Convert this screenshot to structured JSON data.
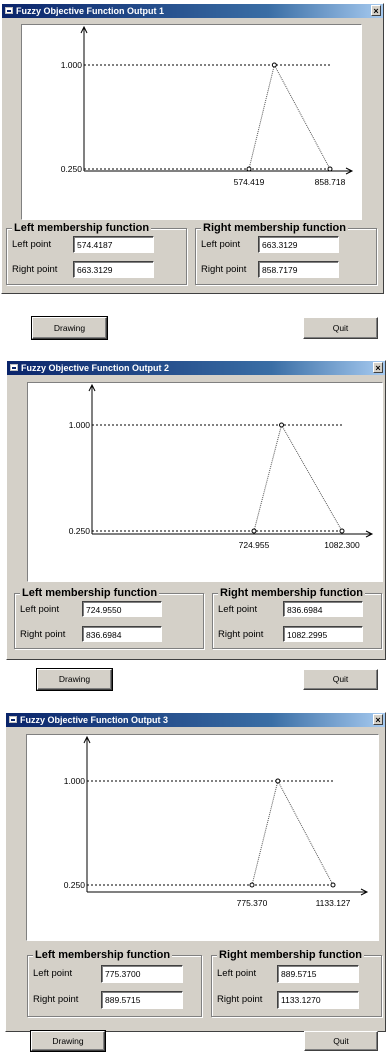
{
  "windows": [
    {
      "title": "Fuzzy Objective Function Output 1",
      "close_label": "×",
      "chart_data": {
        "type": "line",
        "series": [
          {
            "x": [
              574.419,
              663.3129,
              858.718
            ],
            "y": [
              0.25,
              1.0,
              0.25
            ]
          }
        ],
        "y_labels": [
          "1.000",
          "0.250"
        ],
        "x_labels": [
          "574.419",
          "858.718"
        ],
        "xlim": [
          574.419,
          858.718
        ],
        "ylim": [
          0.25,
          1.0
        ]
      },
      "left_group": {
        "title": "Left membership function",
        "left_label": "Left point",
        "left_value": "574.4187",
        "right_label": "Right point",
        "right_value": "663.3129"
      },
      "right_group": {
        "title": "Right membership function",
        "left_label": "Left point",
        "left_value": "663.3129",
        "right_label": "Right point",
        "right_value": "858.7179"
      },
      "drawing_label": "Drawing",
      "quit_label": "Quit"
    },
    {
      "title": "Fuzzy Objective Function Output 2",
      "close_label": "×",
      "chart_data": {
        "type": "line",
        "series": [
          {
            "x": [
              724.955,
              836.6984,
              1082.3
            ],
            "y": [
              0.25,
              1.0,
              0.25
            ]
          }
        ],
        "y_labels": [
          "1.000",
          "0.250"
        ],
        "x_labels": [
          "724.955",
          "1082.300"
        ],
        "xlim": [
          724.955,
          1082.3
        ],
        "ylim": [
          0.25,
          1.0
        ]
      },
      "left_group": {
        "title": "Left membership function",
        "left_label": "Left point",
        "left_value": "724.9550",
        "right_label": "Right point",
        "right_value": "836.6984"
      },
      "right_group": {
        "title": "Right membership function",
        "left_label": "Left point",
        "left_value": "836.6984",
        "right_label": "Right point",
        "right_value": "1082.2995"
      },
      "drawing_label": "Drawing",
      "quit_label": "Quit"
    },
    {
      "title": "Fuzzy Objective Function Output 3",
      "close_label": "×",
      "chart_data": {
        "type": "line",
        "series": [
          {
            "x": [
              775.37,
              889.5715,
              1133.127
            ],
            "y": [
              0.25,
              1.0,
              0.25
            ]
          }
        ],
        "y_labels": [
          "1.000",
          "0.250"
        ],
        "x_labels": [
          "775.370",
          "1133.127"
        ],
        "xlim": [
          775.37,
          1133.127
        ],
        "ylim": [
          0.25,
          1.0
        ]
      },
      "left_group": {
        "title": "Left membership function",
        "left_label": "Left point",
        "left_value": "775.3700",
        "right_label": "Right point",
        "right_value": "889.5715"
      },
      "right_group": {
        "title": "Right membership function",
        "left_label": "Left point",
        "left_value": "889.5715",
        "right_label": "Right point",
        "right_value": "1133.1270"
      },
      "drawing_label": "Drawing",
      "quit_label": "Quit"
    }
  ]
}
